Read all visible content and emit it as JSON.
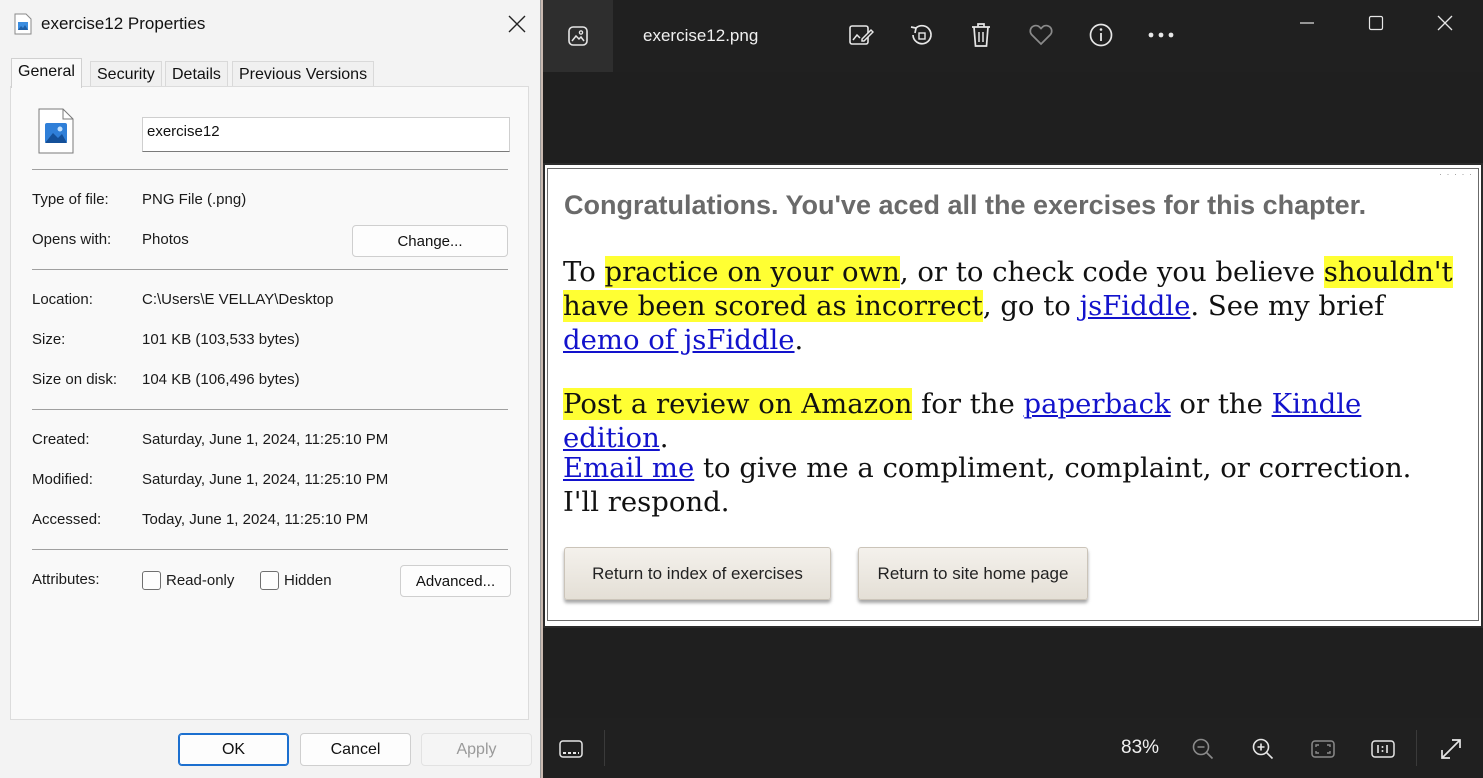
{
  "properties": {
    "title": "exercise12 Properties",
    "tabs": [
      "General",
      "Security",
      "Details",
      "Previous Versions"
    ],
    "file_name": "exercise12",
    "type_label": "Type of file:",
    "type_value": "PNG File (.png)",
    "opens_label": "Opens with:",
    "opens_value": "Photos",
    "change_label": "Change...",
    "location_label": "Location:",
    "location_value": "C:\\Users\\E VELLAY\\Desktop",
    "size_label": "Size:",
    "size_value": "101 KB (103,533 bytes)",
    "size_disk_label": "Size on disk:",
    "size_disk_value": "104 KB (106,496 bytes)",
    "created_label": "Created:",
    "created_value": "Saturday, June 1, 2024, 11:25:10 PM",
    "modified_label": "Modified:",
    "modified_value": "Saturday, June 1, 2024, 11:25:10 PM",
    "accessed_label": "Accessed:",
    "accessed_value": "Today, June 1, 2024, 11:25:10 PM",
    "attributes_label": "Attributes:",
    "readonly_label": "Read-only",
    "hidden_label": "Hidden",
    "advanced_label": "Advanced...",
    "ok_label": "OK",
    "cancel_label": "Cancel",
    "apply_label": "Apply"
  },
  "viewer": {
    "file_name": "exercise12.png",
    "zoom": "83%",
    "image": {
      "heading": "Congratulations. You've aced all the exercises for this chapter.",
      "p1_a": "To ",
      "p1_hl1": "practice on your own",
      "p1_b": ", or to check code you believe ",
      "p1_hl2": "shouldn't have been scored as incorrect",
      "p1_c": ", go to ",
      "p1_link1": "jsFiddle",
      "p1_d": ". See my brief ",
      "p1_link2": "demo of jsFiddle",
      "p1_e": ".",
      "p2_hl": "Post a review on Amazon",
      "p2_a": " for the ",
      "p2_link1": "paperback",
      "p2_b": " or the ",
      "p2_link2": "Kindle edition",
      "p2_c": ".",
      "p3_link": "Email me",
      "p3_a": " to give me a compliment, complaint, or correction. I'll respond.",
      "btn_index": "Return to index of exercises",
      "btn_home": "Return to site home page"
    }
  }
}
